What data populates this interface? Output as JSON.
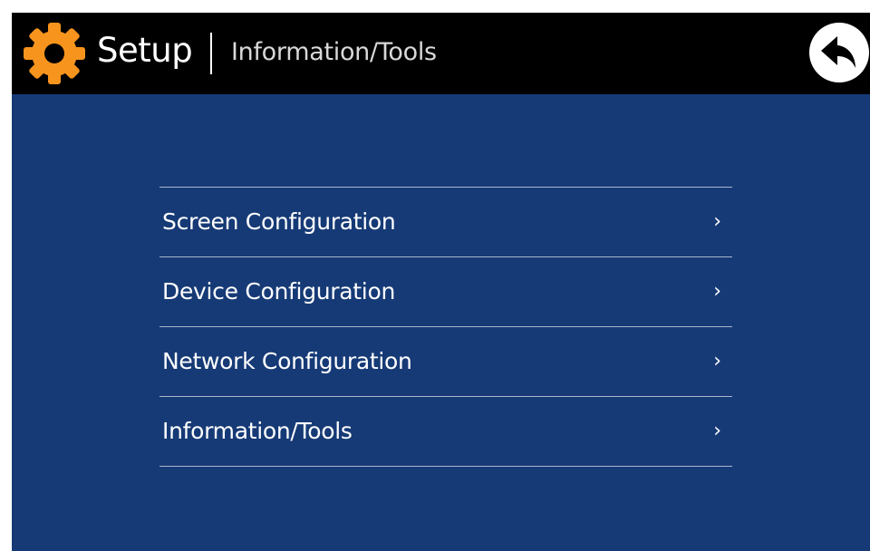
{
  "header": {
    "title": "Setup",
    "subtitle": "Information/Tools",
    "icon": "gear-icon",
    "back_icon": "back-arrow-icon"
  },
  "menu": {
    "items": [
      {
        "label": "Screen Configuration",
        "chevron": "›"
      },
      {
        "label": "Device Configuration",
        "chevron": "›"
      },
      {
        "label": "Network Configuration",
        "chevron": "›"
      },
      {
        "label": "Information/Tools",
        "chevron": "›"
      }
    ]
  },
  "colors": {
    "background": "#163a76",
    "header": "#000000",
    "accent_gear": "#f7941d",
    "text": "#ffffff",
    "divider": "#a9b6cc"
  }
}
